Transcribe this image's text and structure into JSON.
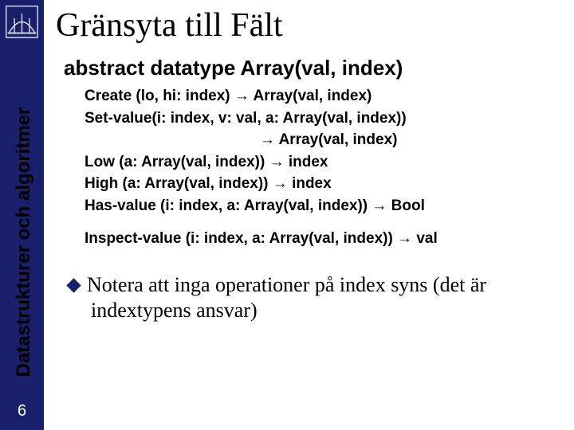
{
  "sidebar": {
    "label": "Datastrukturer och algoritmer",
    "page_number": "6"
  },
  "title": "Gränsyta till Fält",
  "heading": "abstract datatype  Array(val, index)",
  "ops": {
    "create": "Create (lo, hi: index) → Array(val, index)",
    "setvalue1": "Set-value(i: index, v: val, a: Array(val, index))",
    "setvalue2": "→ Array(val, index)",
    "low": "Low (a: Array(val, index)) → index",
    "high": "High (a: Array(val, index)) → index",
    "hasvalue": "Has-value (i: index, a: Array(val, index)) → Bool",
    "inspect": "Inspect-value (i: index, a: Array(val, index)) → val"
  },
  "note_lead": "Notera",
  "note_rest": " att inga operationer på index syns (det är indextypens ansvar)"
}
